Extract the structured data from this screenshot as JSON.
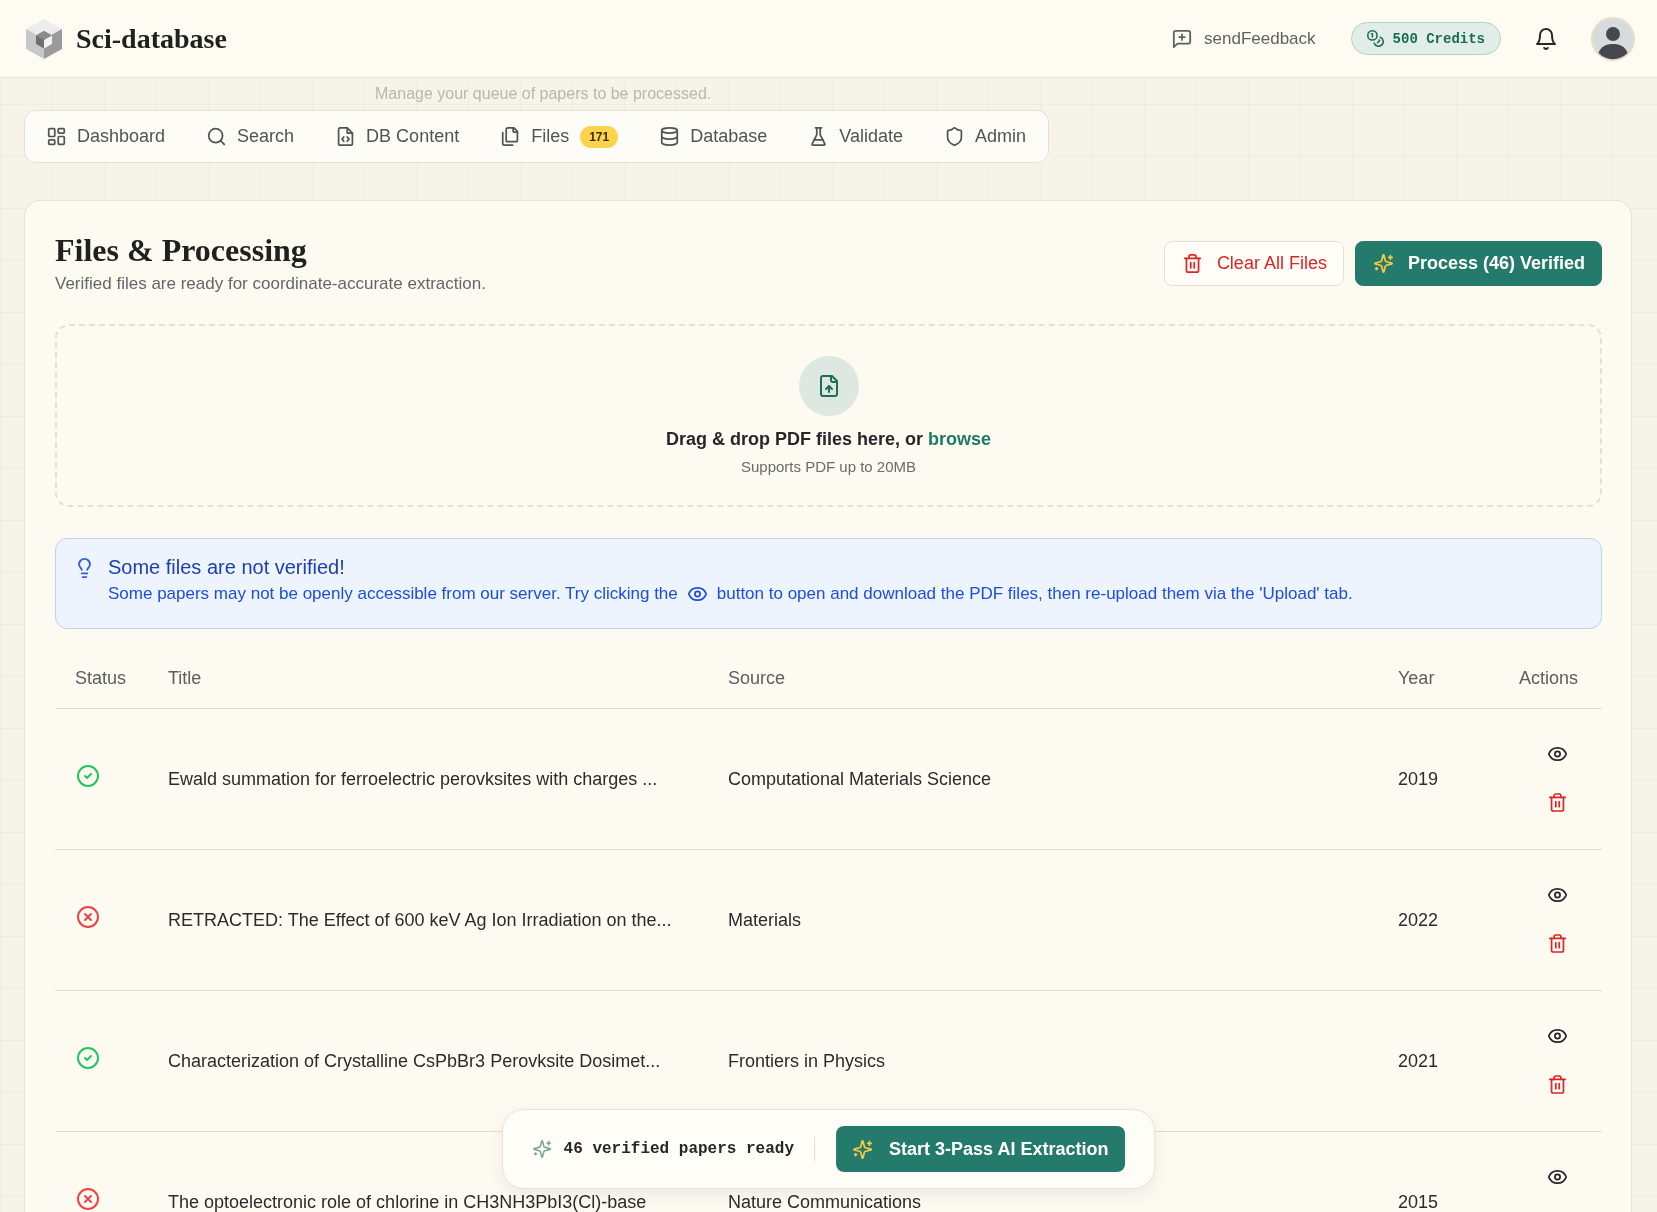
{
  "header": {
    "brand": "Sci-database",
    "feedback": "sendFeedback",
    "credits": "500 Credits"
  },
  "queue_hint": "Manage your queue of papers to be processed.",
  "nav": {
    "tabs": [
      {
        "label": "Dashboard",
        "selected": false
      },
      {
        "label": "Search",
        "selected": false
      },
      {
        "label": "DB Content",
        "selected": false
      },
      {
        "label": "Files",
        "selected": false,
        "badge": "171"
      },
      {
        "label": "Database",
        "selected": false
      },
      {
        "label": "Validate",
        "selected": false
      },
      {
        "label": "Admin",
        "selected": false
      }
    ]
  },
  "panel": {
    "title": "Files & Processing",
    "subtitle": "Verified files are ready for coordinate-accurate extraction.",
    "buttons": [
      {
        "label": "Clear All Files",
        "kind": "danger"
      },
      {
        "label": "Process (46) Verified",
        "kind": "primary"
      }
    ]
  },
  "dropzone": {
    "prompt": "Drag & drop PDF files here, or",
    "link": "browse",
    "note": "Supports PDF up to 20MB"
  },
  "alert": {
    "title": "Some files are not verified!",
    "message_start": "Some papers may not be openly accessible from our server. Try clicking the",
    "message_end": "button to open and download the PDF files, then re-upload them via the 'Upload' tab."
  },
  "table": {
    "columns": [
      "Status",
      "Title",
      "Source",
      "Year",
      "Actions"
    ],
    "rows": [
      {
        "verified": true,
        "title": "Ewald summation for ferroelectric perovksites with charges ...",
        "source": "Computational Materials Science",
        "year": "2019"
      },
      {
        "verified": false,
        "title": "RETRACTED: The Effect of 600 keV Ag Ion Irradiation on the...",
        "source": "Materials",
        "year": "2022"
      },
      {
        "verified": true,
        "title": "Characterization of Crystalline CsPbBr3 Perovksite Dosimet...",
        "source": "Frontiers in Physics",
        "year": "2021"
      },
      {
        "verified": false,
        "title": "The optoelectronic role of chlorine in CH3NH3PbI3(Cl)-base",
        "source": "Nature Communications",
        "year": "2015"
      }
    ]
  },
  "extraction_bar": {
    "summary": "46 verified papers ready",
    "button": "Start 3-Pass AI Extraction"
  }
}
